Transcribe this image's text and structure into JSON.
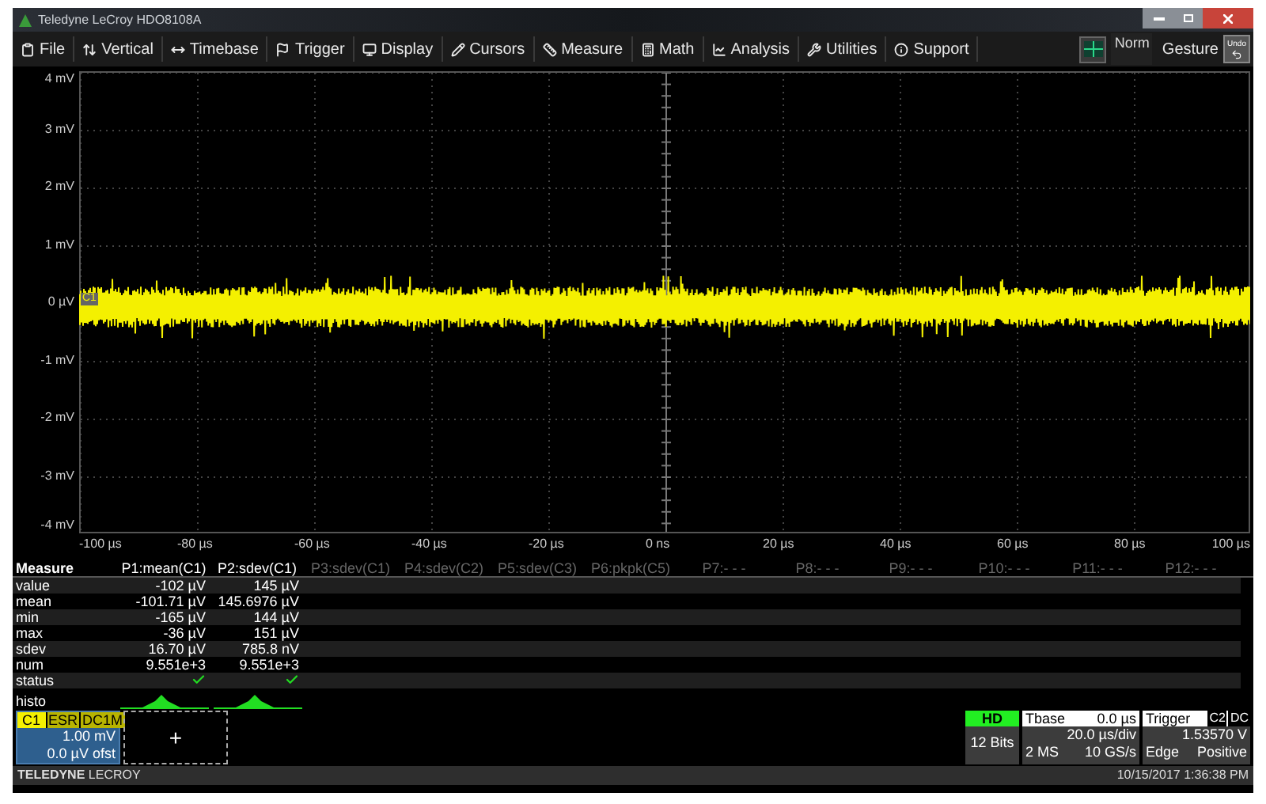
{
  "window": {
    "title": "Teledyne LeCroy HDO8108A"
  },
  "menu": [
    {
      "label": "File"
    },
    {
      "label": "Vertical"
    },
    {
      "label": "Timebase"
    },
    {
      "label": "Trigger"
    },
    {
      "label": "Display"
    },
    {
      "label": "Cursors"
    },
    {
      "label": "Measure"
    },
    {
      "label": "Math"
    },
    {
      "label": "Analysis"
    },
    {
      "label": "Utilities"
    },
    {
      "label": "Support"
    }
  ],
  "toolbar_right": {
    "mode": "Norm",
    "gesture": "Gesture",
    "undo": "Undo"
  },
  "plot": {
    "channel_marker": "C1",
    "y_labels": [
      "4 mV",
      "3 mV",
      "2 mV",
      "1 mV",
      "0 µV",
      "-1 mV",
      "-2 mV",
      "-3 mV",
      "-4 mV"
    ],
    "x_labels": [
      "-100 µs",
      "-80 µs",
      "-60 µs",
      "-40 µs",
      "-20 µs",
      "0 ns",
      "20 µs",
      "40 µs",
      "60 µs",
      "80 µs",
      "100 µs"
    ]
  },
  "measure": {
    "title": "Measure",
    "columns": [
      {
        "label": "P1:mean(C1)",
        "active": true
      },
      {
        "label": "P2:sdev(C1)",
        "active": true
      },
      {
        "label": "P3:sdev(C1)",
        "active": false
      },
      {
        "label": "P4:sdev(C2)",
        "active": false
      },
      {
        "label": "P5:sdev(C3)",
        "active": false
      },
      {
        "label": "P6:pkpk(C5)",
        "active": false
      },
      {
        "label": "P7:- - -",
        "active": false
      },
      {
        "label": "P8:- - -",
        "active": false
      },
      {
        "label": "P9:- - -",
        "active": false
      },
      {
        "label": "P10:- - -",
        "active": false
      },
      {
        "label": "P11:- - -",
        "active": false
      },
      {
        "label": "P12:- - -",
        "active": false
      }
    ],
    "rows": [
      {
        "kind": "text",
        "label": "value",
        "cells": [
          "-102 µV",
          "145 µV"
        ]
      },
      {
        "kind": "text",
        "label": "mean",
        "cells": [
          "-101.71 µV",
          "145.6976 µV"
        ]
      },
      {
        "kind": "text",
        "label": "min",
        "cells": [
          "-165 µV",
          "144 µV"
        ]
      },
      {
        "kind": "text",
        "label": "max",
        "cells": [
          "-36 µV",
          "151 µV"
        ]
      },
      {
        "kind": "text",
        "label": "sdev",
        "cells": [
          "16.70 µV",
          "785.8 nV"
        ]
      },
      {
        "kind": "text",
        "label": "num",
        "cells": [
          "9.551e+3",
          "9.551e+3"
        ]
      },
      {
        "kind": "status",
        "label": "status",
        "passed": [
          true,
          true
        ]
      },
      {
        "kind": "histo",
        "label": "histo"
      }
    ]
  },
  "channel": {
    "name": "C1",
    "tags": [
      "ESR",
      "DC1M"
    ],
    "scale": "1.00 mV",
    "offset": "0.0 µV ofst"
  },
  "add_channel": "+",
  "hd": {
    "label": "HD",
    "bits": "12 Bits"
  },
  "timebase": {
    "label": "Tbase",
    "delay": "0.0 µs",
    "per_div": "20.0 µs/div",
    "samples": "2 MS",
    "rate": "10 GS/s"
  },
  "trigger": {
    "label": "Trigger",
    "source": "C2",
    "coupling": "DC",
    "level": "1.53570 V",
    "type": "Edge",
    "slope": "Positive"
  },
  "footer": {
    "brand_bold": "TELEDYNE",
    "brand": "LECROY",
    "datetime": "10/15/2017 1:36:38 PM"
  }
}
